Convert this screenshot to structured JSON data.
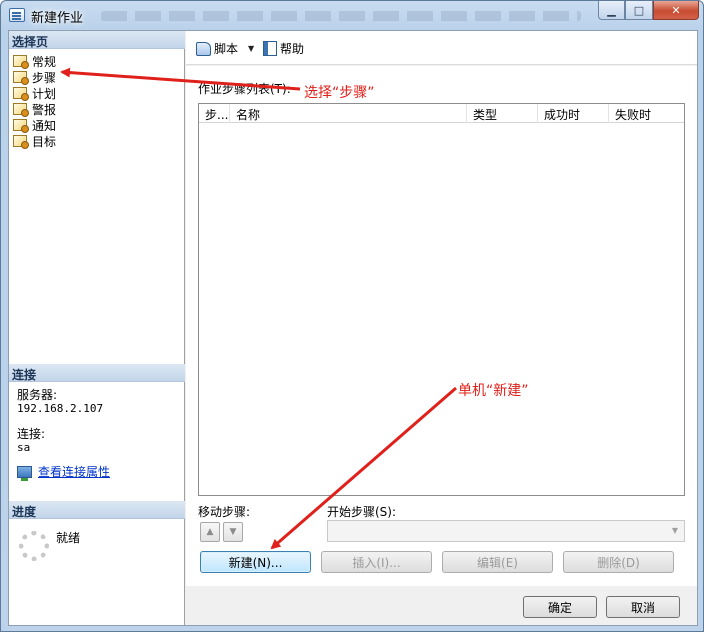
{
  "window": {
    "title": "新建作业",
    "buttons": {
      "minimize": "▁",
      "maximize": "□",
      "close": "✕"
    }
  },
  "left": {
    "select_page_header": "选择页",
    "pages": [
      {
        "label": "常规",
        "icon": "page-icon"
      },
      {
        "label": "步骤",
        "icon": "page-icon"
      },
      {
        "label": "计划",
        "icon": "page-icon"
      },
      {
        "label": "警报",
        "icon": "page-icon"
      },
      {
        "label": "通知",
        "icon": "page-icon"
      },
      {
        "label": "目标",
        "icon": "page-icon"
      }
    ],
    "connection_header": "连接",
    "server_label": "服务器:",
    "server_value": "192.168.2.107",
    "connection_label": "连接:",
    "connection_value": "sa",
    "view_conn_link": "查看连接属性",
    "progress_header": "进度",
    "progress_status": "就绪"
  },
  "toolbar": {
    "script_label": "脚本",
    "help_label": "帮助"
  },
  "main": {
    "list_label": "作业步骤列表(T):",
    "columns": [
      "步...",
      "名称",
      "类型",
      "成功时",
      "失败时"
    ],
    "move_label": "移动步骤:",
    "start_label": "开始步骤(S):",
    "start_value": "",
    "buttons": {
      "new": "新建(N)...",
      "insert": "插入(I)...",
      "edit": "编辑(E)",
      "delete": "删除(D)"
    }
  },
  "footer": {
    "ok": "确定",
    "cancel": "取消"
  },
  "annotations": {
    "select_steps": "选择“步骤”",
    "click_new": "单机“新建”",
    "color": "#e0201a"
  }
}
